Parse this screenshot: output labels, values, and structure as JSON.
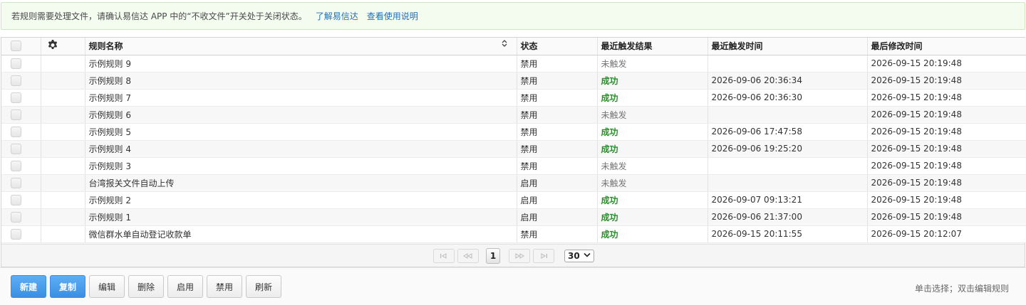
{
  "notice": {
    "text": "若规则需要处理文件，请确认易信达 APP 中的“不收文件”开关处于关闭状态。",
    "link1": "了解易信达",
    "link2": "查看使用说明"
  },
  "table": {
    "headers": [
      "规则名称",
      "状态",
      "最近触发结果",
      "最近触发时间",
      "最后修改时间"
    ],
    "sort_icon": "⌃⌄",
    "rows": [
      {
        "name": "示例规则 9",
        "status": "禁用",
        "result": "未触发",
        "result_type": "none",
        "trigger_time": "",
        "modified": "2026-09-15 20:19:48"
      },
      {
        "name": "示例规则 8",
        "status": "禁用",
        "result": "成功",
        "result_type": "ok",
        "trigger_time": "2026-09-06 20:36:34",
        "modified": "2026-09-15 20:19:48"
      },
      {
        "name": "示例规则 7",
        "status": "禁用",
        "result": "成功",
        "result_type": "ok",
        "trigger_time": "2026-09-06 20:36:30",
        "modified": "2026-09-15 20:19:48"
      },
      {
        "name": "示例规则 6",
        "status": "禁用",
        "result": "未触发",
        "result_type": "none",
        "trigger_time": "",
        "modified": "2026-09-15 20:19:48"
      },
      {
        "name": "示例规则 5",
        "status": "禁用",
        "result": "成功",
        "result_type": "ok",
        "trigger_time": "2026-09-06 17:47:58",
        "modified": "2026-09-15 20:19:48"
      },
      {
        "name": "示例规则 4",
        "status": "禁用",
        "result": "成功",
        "result_type": "ok",
        "trigger_time": "2026-09-06 19:25:20",
        "modified": "2026-09-15 20:19:48"
      },
      {
        "name": "示例规则 3",
        "status": "禁用",
        "result": "未触发",
        "result_type": "none",
        "trigger_time": "",
        "modified": "2026-09-15 20:19:48"
      },
      {
        "name": "台湾报关文件自动上传",
        "status": "启用",
        "result": "未触发",
        "result_type": "none",
        "trigger_time": "",
        "modified": "2026-09-15 20:19:48"
      },
      {
        "name": "示例规则 2",
        "status": "启用",
        "result": "成功",
        "result_type": "ok",
        "trigger_time": "2026-09-07 09:13:21",
        "modified": "2026-09-15 20:19:48"
      },
      {
        "name": "示例规则 1",
        "status": "启用",
        "result": "成功",
        "result_type": "ok",
        "trigger_time": "2026-09-06 21:37:00",
        "modified": "2026-09-15 20:19:48"
      },
      {
        "name": "微信群水单自动登记收款单",
        "status": "禁用",
        "result": "成功",
        "result_type": "ok",
        "trigger_time": "2026-09-15 20:11:55",
        "modified": "2026-09-15 20:12:07"
      }
    ]
  },
  "pager": {
    "first": "I◁",
    "prev": "◁◁",
    "current_page": "1",
    "next": "▷▷",
    "last": "▷I",
    "page_size": "30",
    "page_size_icon": "chevron-down-icon"
  },
  "toolbar": {
    "new": "新建",
    "copy": "复制",
    "edit": "编辑",
    "delete": "删除",
    "enable": "启用",
    "disable": "禁用",
    "refresh": "刷新",
    "hint": "单击选择；双击编辑规则"
  },
  "colors": {
    "primary": "#3a8fe2",
    "success": "#2f8a2f",
    "link": "#1f6fbf",
    "notice_bg": "#f4fbef"
  }
}
